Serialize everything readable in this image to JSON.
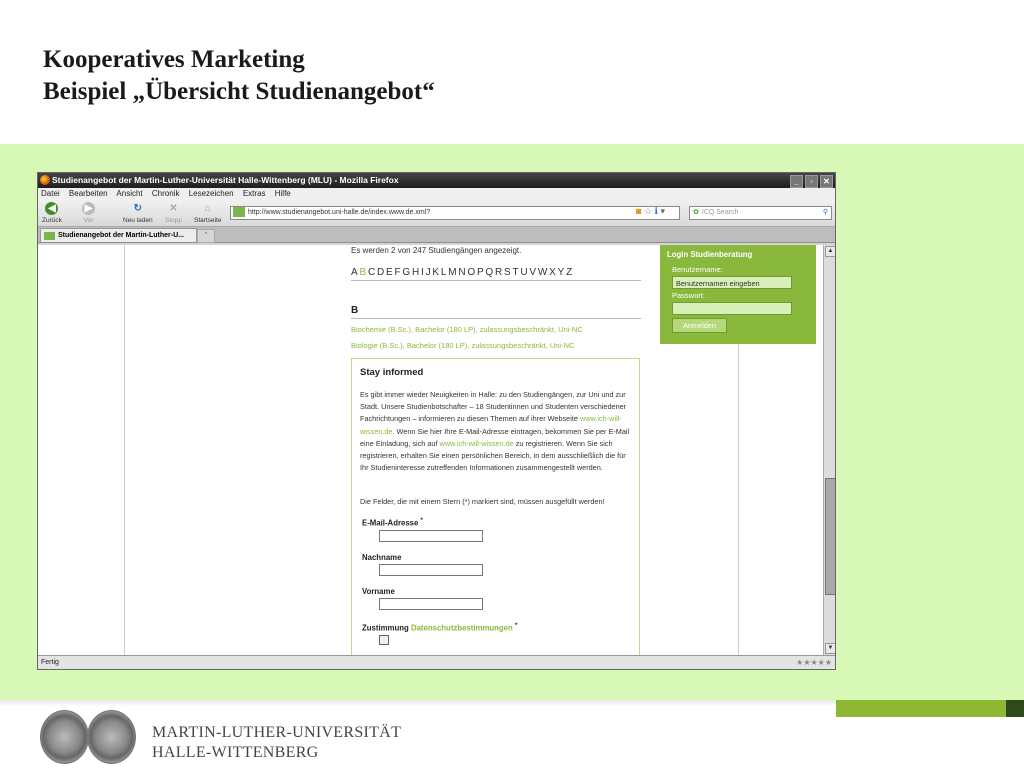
{
  "slide": {
    "title_line1": "Kooperatives Marketing",
    "title_line2": "Beispiel „Übersicht Studienangebot“"
  },
  "footer": {
    "university_line1": "MARTIN-LUTHER-UNIVERSITÄT",
    "university_line2": "HALLE-WITTENBERG"
  },
  "browser": {
    "window_title": "Studienangebot der Martin-Luther-Universität Halle-Wittenberg (MLU) - Mozilla Firefox",
    "menu": [
      "Datei",
      "Bearbeiten",
      "Ansicht",
      "Chronik",
      "Lesezeichen",
      "Extras",
      "Hilfe"
    ],
    "nav": {
      "back": "Zurück",
      "forward": "Vor",
      "reload": "Neu laden",
      "stop": "Stopp",
      "home": "Startseite"
    },
    "url": "http://www.studienangebot.uni-halle.de/index.www.de.xml?",
    "search_placeholder": "ICQ Search",
    "tab_title": "Studienangebot der Martin-Luther-U...",
    "status": "Fertig"
  },
  "page": {
    "count_text": "Es werden 2 von 247 Studiengängen angezeigt.",
    "alphabet": [
      "A",
      "B",
      "C",
      "D",
      "E",
      "F",
      "G",
      "H",
      "I",
      "J",
      "K",
      "L",
      "M",
      "N",
      "O",
      "P",
      "Q",
      "R",
      "S",
      "T",
      "U",
      "V",
      "W",
      "X",
      "Y",
      "Z"
    ],
    "active_letter": "B",
    "section_letter": "B",
    "courses": [
      "Biochemie (B.Sc.), Bachelor (180 LP), zulassungsbeschränkt, Uni-NC",
      "Biologie (B.Sc.), Bachelor (180 LP), zulassungsbeschränkt, Uni-NC"
    ],
    "login": {
      "title": "Login Studienberatung",
      "username_label": "Benutzername:",
      "username_value": "Benutzernamen eingeben",
      "password_label": "Passwort:",
      "submit": "Anmelden"
    },
    "stay_informed": {
      "heading": "Stay informed",
      "intro_a": "Es gibt immer wieder Neuigkeiten in Halle: zu den Studiengängen, zur Uni und zur Stadt. Unsere Studienbotschafter – 18 Studentinnen und Studenten verschiedener Fachrichtungen – informieren zu diesen Themen auf ihrer Webseite ",
      "link1": "www.ich-will-wissen.de",
      "intro_b": ". Wenn Sie hier Ihre E-Mail-Adresse eintragen, bekommen Sie per E-Mail eine Einladung, sich auf ",
      "link2": "www.ich-will-wissen.de",
      "intro_c": " zu registrieren. Wenn Sie sich registrieren, erhalten Sie einen persönlichen Bereich, in dem ausschließlich die für Ihr Studieninteresse zutreffenden Informationen zusammengestellt werden.",
      "required_note": "Die Felder, die mit einem Stern (*) markiert sind, müssen ausgefüllt werden!",
      "email_label": "E-Mail-Adresse",
      "lastname_label": "Nachname",
      "firstname_label": "Vorname",
      "consent_label": "Zustimmung",
      "consent_link": "Datenschutzbestimmungen",
      "required_marker": "*"
    }
  },
  "colors": {
    "accent_green": "#8ab83c",
    "slide_band": "#d8f8b8"
  }
}
